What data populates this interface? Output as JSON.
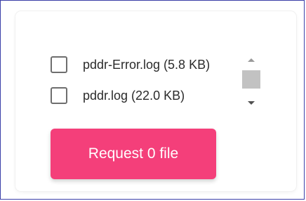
{
  "colors": {
    "accent": "#f43f7a",
    "frame_border": "#3a3fa8",
    "checkbox_border": "#6e6e6e",
    "scroll_thumb": "#c2c2c2"
  },
  "files": [
    {
      "label": "pddr-Error.log (5.8 KB)",
      "checked": false
    },
    {
      "label": "pddr.log (22.0 KB)",
      "checked": false
    }
  ],
  "scrollbar": {
    "up_icon": "triangle-up-icon",
    "down_icon": "triangle-down-icon"
  },
  "request_button": {
    "label": "Request 0 file"
  }
}
